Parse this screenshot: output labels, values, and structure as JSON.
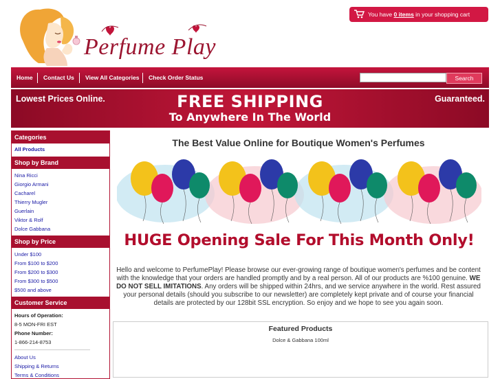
{
  "header": {
    "logo_text": "Perfume Play",
    "cart": {
      "prefix": "You have ",
      "items": "0 items",
      "suffix": " in your shopping cart"
    }
  },
  "nav": {
    "items": [
      "Home",
      "Contact Us",
      "View All Categories",
      "Check Order Status"
    ],
    "search_value": "",
    "search_button": "Search"
  },
  "banner": {
    "left": "Lowest Prices Online.",
    "right": "Guaranteed.",
    "line1": "FREE SHIPPING",
    "line2": "To Anywhere In The World"
  },
  "sidebar": {
    "categories_heading": "Categories",
    "all_products": "All Products",
    "brand_heading": "Shop by Brand",
    "brands": [
      "Nina Ricci",
      "Giorgio Armani",
      "Cacharel",
      "Thierry Mugler",
      "Guerlain",
      "Viktor & Rolf",
      "Dolce Gabbana"
    ],
    "price_heading": "Shop by Price",
    "prices": [
      "Under $100",
      "From $100 to $200",
      "From $200 to $300",
      "From $300 to $500",
      "$500 and above"
    ],
    "service_heading": "Customer Service",
    "hours_label": "Hours of Operation:",
    "hours_value": "8-5 MON-FRI EST",
    "phone_label": "Phone Number:",
    "phone_value": "1-866-214-8753",
    "links": [
      "About Us",
      "Shipping & Returns",
      "Terms & Conditions"
    ]
  },
  "main": {
    "title": "The Best Value Online for Boutique Women's Perfumes",
    "sale_text": "HUGE Opening Sale For This Month Only!",
    "welcome_1": "Hello and welcome to PerfumePlay! Please browse our ever-growing range of boutique women's perfumes and be content with the knowledge that your orders are handled promptly and by a real person. All of our products are %100 genuine. ",
    "welcome_bold": "WE DO NOT SELL IMITATIONS",
    "welcome_2": ". Any orders will be shipped within 24hrs, and we service anywhere in the world. Rest assured your personal details (should you subscribe to our newsletter) are completely kept private and of course your financial details are protected by our 128bit SSL encryption. So enjoy and we hope to see you again soon.",
    "featured_title": "Featured Products",
    "featured_item": "Dolce & Gabbana 100ml"
  },
  "colors": {
    "brand_red": "#a8102f",
    "cart_red": "#d21844",
    "link_blue": "#1a1aa6"
  }
}
